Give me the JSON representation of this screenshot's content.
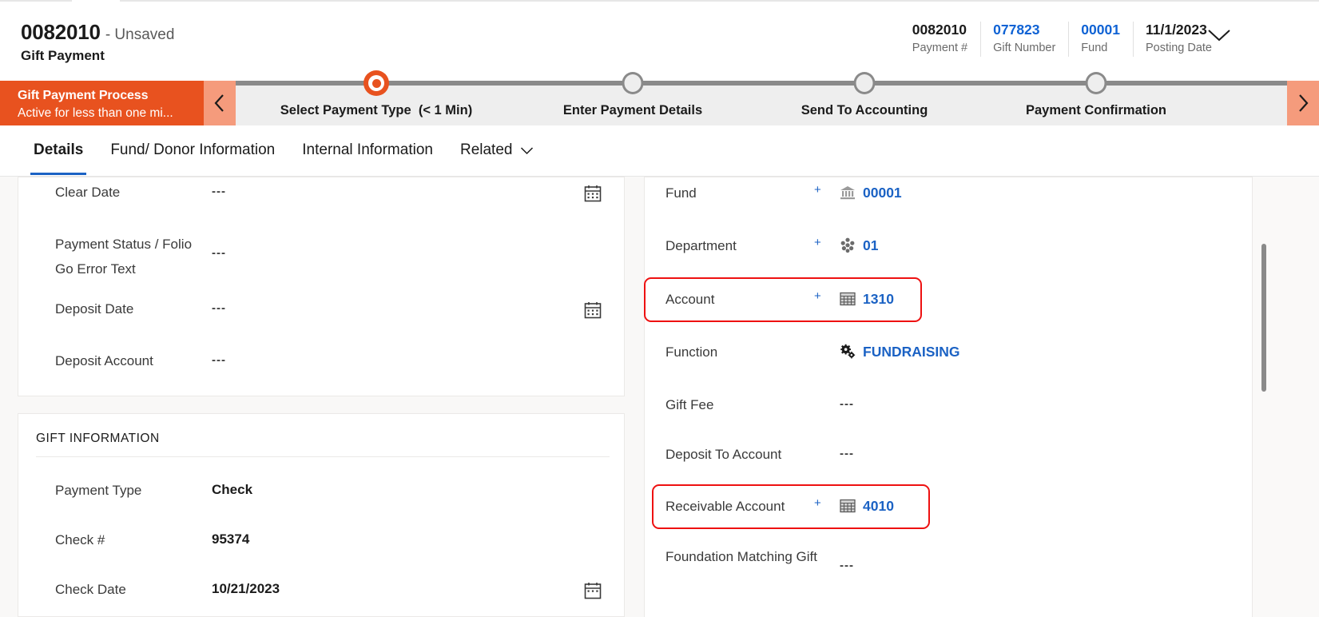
{
  "header": {
    "record_id": "0082010",
    "unsaved_label": "- Unsaved",
    "entity_name": "Gift Payment",
    "quick_fields": [
      {
        "value": "0082010",
        "label": "Payment #",
        "link": false
      },
      {
        "value": "077823",
        "label": "Gift Number",
        "link": true
      },
      {
        "value": "00001",
        "label": "Fund",
        "link": true
      },
      {
        "value": "11/1/2023",
        "label": "Posting Date",
        "link": false
      }
    ],
    "expand_icon": "chevron-down-icon"
  },
  "process_flow": {
    "name": "Gift Payment Process",
    "status": "Active for less than one mi...",
    "prev_icon": "chevron-left-icon",
    "next_icon": "chevron-right-icon",
    "stages": [
      {
        "label": "Select Payment Type",
        "duration": "(< 1 Min)",
        "state": "active"
      },
      {
        "label": "Enter Payment Details",
        "duration": "",
        "state": "pending"
      },
      {
        "label": "Send To Accounting",
        "duration": "",
        "state": "pending"
      },
      {
        "label": "Payment Confirmation",
        "duration": "",
        "state": "pending"
      }
    ]
  },
  "tabs": [
    {
      "label": "Details",
      "active": true,
      "caret": false
    },
    {
      "label": "Fund/ Donor Information",
      "active": false,
      "caret": false
    },
    {
      "label": "Internal Information",
      "active": false,
      "caret": false
    },
    {
      "label": "Related",
      "active": false,
      "caret": true
    }
  ],
  "left_column": {
    "payment_card": {
      "fields": [
        {
          "label": "Clear Date",
          "value": "---",
          "calendar": true,
          "icon": null,
          "required": false,
          "link": false,
          "bold": false
        },
        {
          "label": "Payment Status / Folio Go Error Text",
          "value": "---",
          "calendar": false,
          "icon": null,
          "required": false,
          "link": false,
          "bold": false
        },
        {
          "label": "Deposit Date",
          "value": "---",
          "calendar": true,
          "icon": null,
          "required": false,
          "link": false,
          "bold": false
        },
        {
          "label": "Deposit Account",
          "value": "---",
          "calendar": false,
          "icon": null,
          "required": false,
          "link": false,
          "bold": false
        }
      ]
    },
    "gift_card": {
      "title": "GIFT INFORMATION",
      "fields": [
        {
          "label": "Payment Type",
          "value": "Check",
          "calendar": false,
          "icon": null,
          "required": false,
          "link": false,
          "bold": true
        },
        {
          "label": "Check #",
          "value": "95374",
          "calendar": false,
          "icon": null,
          "required": false,
          "link": false,
          "bold": true
        },
        {
          "label": "Check Date",
          "value": "10/21/2023",
          "calendar": true,
          "icon": null,
          "required": false,
          "link": false,
          "bold": true
        }
      ]
    }
  },
  "right_column": {
    "fields": [
      {
        "label": "Fund",
        "value": "00001",
        "icon": "bank-icon",
        "required": true,
        "link": true,
        "highlight": false
      },
      {
        "label": "Department",
        "value": "01",
        "icon": "cluster-icon",
        "required": true,
        "link": true,
        "highlight": false
      },
      {
        "label": "Account",
        "value": "1310",
        "icon": "ledger-icon",
        "required": true,
        "link": true,
        "highlight": true
      },
      {
        "label": "Function",
        "value": "FUNDRAISING",
        "icon": "gears-icon",
        "required": false,
        "link": true,
        "highlight": false
      },
      {
        "label": "Gift Fee",
        "value": "---",
        "icon": null,
        "required": false,
        "link": false,
        "highlight": false
      },
      {
        "label": "Deposit To Account",
        "value": "---",
        "icon": null,
        "required": false,
        "link": false,
        "highlight": false
      },
      {
        "label": "Receivable Account",
        "value": "4010",
        "icon": "ledger-icon",
        "required": true,
        "link": true,
        "highlight": true
      },
      {
        "label": "Foundation Matching Gift",
        "value": "---",
        "icon": null,
        "required": false,
        "link": false,
        "highlight": false
      }
    ]
  },
  "colors": {
    "process_orange": "#e8521f",
    "process_orange_light": "#f59b7c",
    "link_blue": "#1b62c4",
    "highlight_red": "#ee1111",
    "tab_underline": "#1b62c4"
  },
  "scrollbars": {
    "page_scroll_visible": true,
    "inner_scroll_visible": true
  }
}
